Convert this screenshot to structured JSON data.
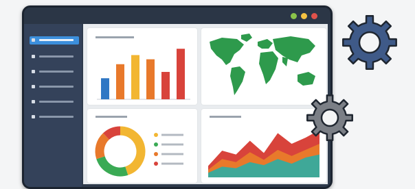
{
  "window": {
    "controls": [
      {
        "name": "minimize-dot",
        "color": "#8bc34a"
      },
      {
        "name": "maximize-dot",
        "color": "#f5c242"
      },
      {
        "name": "close-dot",
        "color": "#e0524b"
      }
    ]
  },
  "sidebar": {
    "items": [
      {
        "name": "sidebar-item-1",
        "active": true
      },
      {
        "name": "sidebar-item-2",
        "active": false
      },
      {
        "name": "sidebar-item-3",
        "active": false
      },
      {
        "name": "sidebar-item-4",
        "active": false
      },
      {
        "name": "sidebar-item-5",
        "active": false
      },
      {
        "name": "sidebar-item-6",
        "active": false
      }
    ]
  },
  "colors": {
    "blue": "#2f77c4",
    "orange": "#e8792b",
    "yellow": "#f2b632",
    "red": "#d8433b",
    "green": "#3aaa54",
    "teal": "#3fa898",
    "map_green": "#2e9a4c",
    "gear_blue": "#3f5a88",
    "gear_gray": "#7b7f86"
  },
  "chart_data": [
    {
      "type": "bar",
      "categories": [
        "",
        "",
        "",
        "",
        "",
        ""
      ],
      "values": [
        3,
        5,
        6.3,
        5.7,
        3.9,
        7.2
      ],
      "colors": [
        "#2f77c4",
        "#e8792b",
        "#f2b632",
        "#e8792b",
        "#d8433b",
        "#d8433b"
      ],
      "ylim": [
        0,
        8
      ]
    },
    {
      "type": "pie",
      "labels": [
        "",
        "",
        "",
        ""
      ],
      "values": [
        45,
        25,
        18,
        12
      ],
      "colors": [
        "#f2b632",
        "#3aaa54",
        "#e8792b",
        "#d8433b"
      ],
      "donut": true
    },
    {
      "type": "area",
      "x": [
        0,
        1,
        2,
        3,
        4,
        5,
        6,
        7,
        8
      ],
      "series": [
        {
          "values": [
            1.5,
            3.5,
            3.0,
            4.8,
            3.2,
            5.8,
            4.4,
            5.2,
            6.2
          ],
          "color": "#d8433b"
        },
        {
          "values": [
            1.0,
            2.4,
            2.0,
            3.3,
            2.3,
            3.6,
            2.8,
            3.6,
            4.4
          ],
          "color": "#e8792b"
        },
        {
          "values": [
            0.6,
            1.4,
            1.2,
            2.0,
            1.6,
            2.4,
            1.8,
            2.6,
            3.0
          ],
          "color": "#3fa898"
        }
      ],
      "ylim": [
        0,
        7
      ]
    }
  ]
}
